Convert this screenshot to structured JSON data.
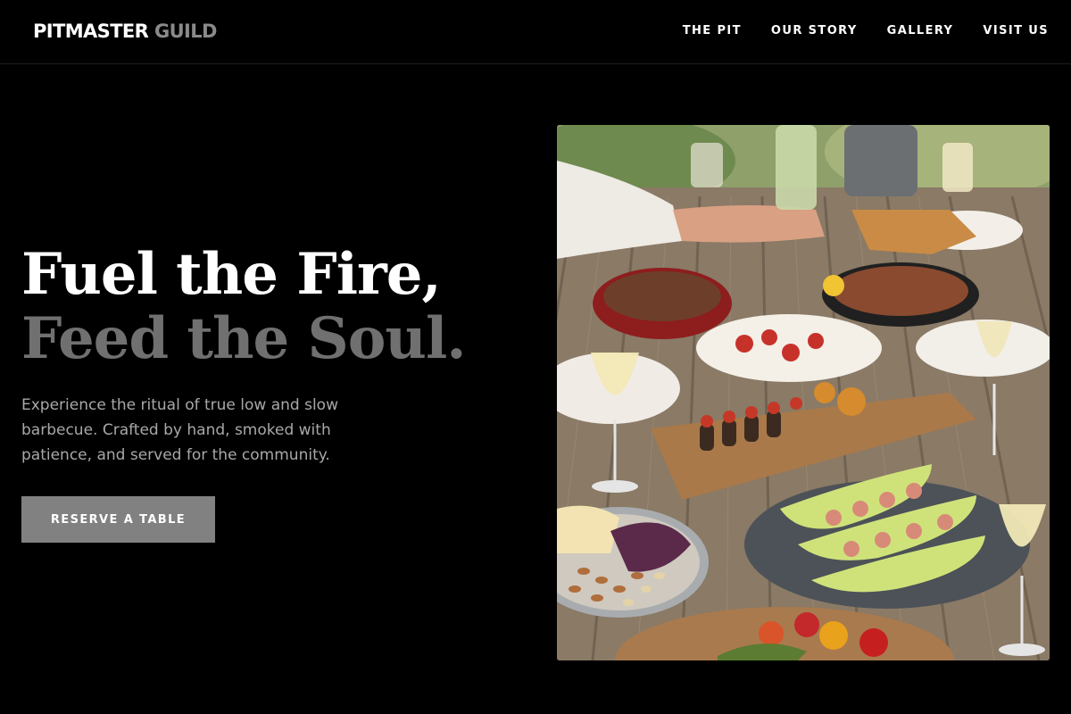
{
  "header": {
    "brand_primary": "PITMASTER",
    "brand_secondary": "GUILD",
    "nav": [
      {
        "label": "THE PIT"
      },
      {
        "label": "OUR STORY"
      },
      {
        "label": "GALLERY"
      },
      {
        "label": "VISIT US"
      }
    ]
  },
  "hero": {
    "title_line1": "Fuel the Fire,",
    "title_line2": "Feed the Soul.",
    "description": "Experience the ritual of true low and slow barbecue. Crafted by hand, smoked with patience, and served for the community.",
    "cta_label": "RESERVE A TABLE",
    "image_subject": "outdoor wooden table with barbecue dishes, melon with prosciutto, nuts and white wine"
  },
  "colors": {
    "background": "#000000",
    "text_primary": "#ffffff",
    "text_muted": "#707070",
    "body_text": "#a8a8a8",
    "button_bg": "#818181"
  }
}
